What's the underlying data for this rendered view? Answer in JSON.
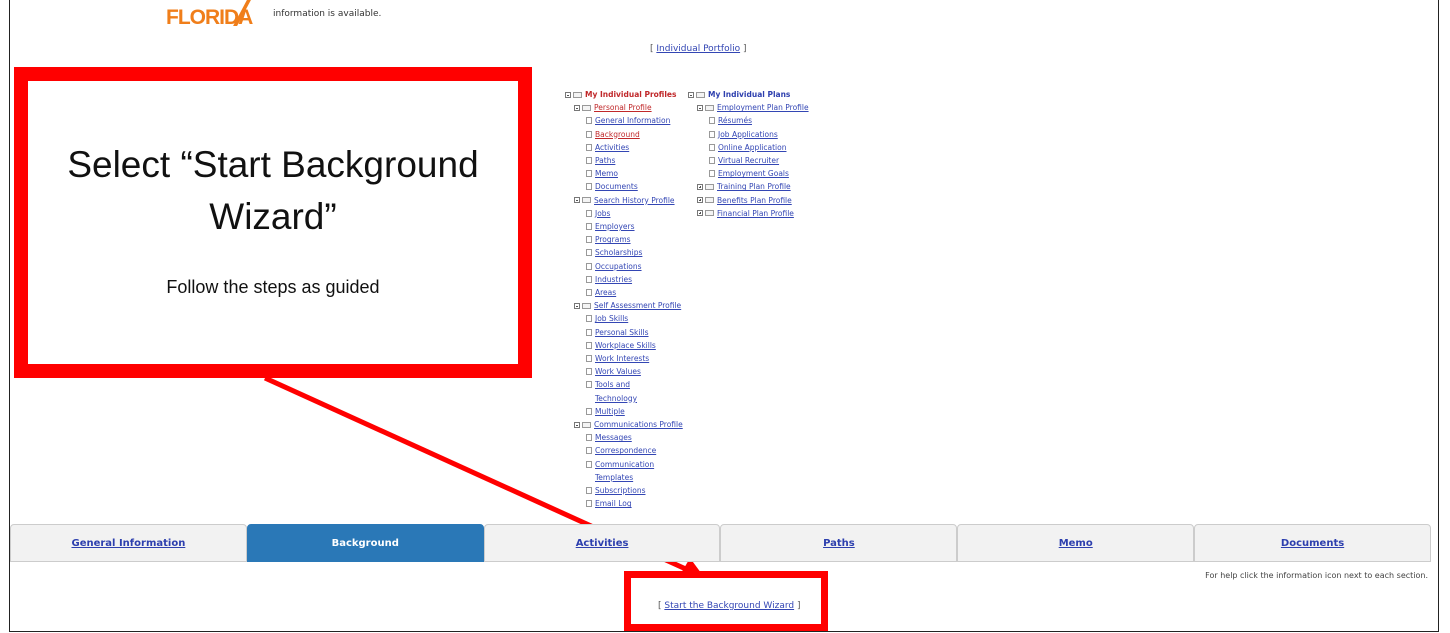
{
  "header": {
    "logo_text": "FLORIDA",
    "info_text": "information is available.",
    "portfolio_link": "Individual Portfolio"
  },
  "tree_left": [
    {
      "label": "My Individual Profiles",
      "kind": "root"
    },
    {
      "label": "Personal Profile",
      "kind": "folder-red"
    },
    {
      "label": "General Information",
      "kind": "leaf-blue"
    },
    {
      "label": "Background",
      "kind": "leaf-red"
    },
    {
      "label": "Activities",
      "kind": "leaf-blue"
    },
    {
      "label": "Paths",
      "kind": "leaf-blue"
    },
    {
      "label": "Memo",
      "kind": "leaf-blue"
    },
    {
      "label": "Documents",
      "kind": "leaf-blue"
    },
    {
      "label": "Search History Profile",
      "kind": "folder-blue"
    },
    {
      "label": "Jobs",
      "kind": "leaf-blue"
    },
    {
      "label": "Employers",
      "kind": "leaf-blue"
    },
    {
      "label": "Programs",
      "kind": "leaf-blue"
    },
    {
      "label": "Scholarships",
      "kind": "leaf-blue"
    },
    {
      "label": "Occupations",
      "kind": "leaf-blue"
    },
    {
      "label": "Industries",
      "kind": "leaf-blue"
    },
    {
      "label": "Areas",
      "kind": "leaf-blue"
    },
    {
      "label": "Self Assessment Profile",
      "kind": "folder-blue"
    },
    {
      "label": "Job Skills",
      "kind": "leaf-blue"
    },
    {
      "label": "Personal Skills",
      "kind": "leaf-blue"
    },
    {
      "label": "Workplace Skills",
      "kind": "leaf-blue"
    },
    {
      "label": "Work Interests",
      "kind": "leaf-blue"
    },
    {
      "label": "Work Values",
      "kind": "leaf-blue"
    },
    {
      "label": "Tools and",
      "kind": "leaf-blue"
    },
    {
      "label": "Technology",
      "kind": "cont-blue"
    },
    {
      "label": "Multiple",
      "kind": "leaf-blue"
    },
    {
      "label": "Communications Profile",
      "kind": "folder-blue"
    },
    {
      "label": "Messages",
      "kind": "leaf-blue"
    },
    {
      "label": "Correspondence",
      "kind": "leaf-blue"
    },
    {
      "label": "Communication",
      "kind": "leaf-blue"
    },
    {
      "label": "Templates",
      "kind": "cont-blue"
    },
    {
      "label": "Subscriptions",
      "kind": "leaf-blue"
    },
    {
      "label": "Email Log",
      "kind": "leaf-blue"
    }
  ],
  "tree_right": [
    {
      "label": "My Individual Plans",
      "kind": "root-blue"
    },
    {
      "label": "Employment Plan Profile",
      "kind": "folder-blue"
    },
    {
      "label": "Résumés",
      "kind": "leaf-blue"
    },
    {
      "label": "Job Applications",
      "kind": "leaf-blue"
    },
    {
      "label": "Online Application",
      "kind": "leaf-blue"
    },
    {
      "label": "Virtual Recruiter",
      "kind": "leaf-blue"
    },
    {
      "label": "Employment Goals",
      "kind": "leaf-blue"
    },
    {
      "label": "Training Plan Profile",
      "kind": "folder-collapsed"
    },
    {
      "label": "Benefits Plan Profile",
      "kind": "folder-collapsed"
    },
    {
      "label": "Financial Plan Profile",
      "kind": "folder-collapsed"
    }
  ],
  "callout": {
    "title": "Select “Start Background Wizard”",
    "subtitle": "Follow the steps as guided"
  },
  "tabs": [
    {
      "label": "General Information",
      "active": false
    },
    {
      "label": "Background",
      "active": true
    },
    {
      "label": "Activities",
      "active": false
    },
    {
      "label": "Paths",
      "active": false
    },
    {
      "label": "Memo",
      "active": false
    },
    {
      "label": "Documents",
      "active": false
    }
  ],
  "help_text": "For help click the information icon next to each section.",
  "wizard_link": "Start the Background Wizard",
  "colors": {
    "callout_border": "#ff0000",
    "active_tab": "#2a78b7",
    "link_blue": "#3346b4",
    "link_red": "#c0282a",
    "logo_orange": "#f07e1a"
  }
}
